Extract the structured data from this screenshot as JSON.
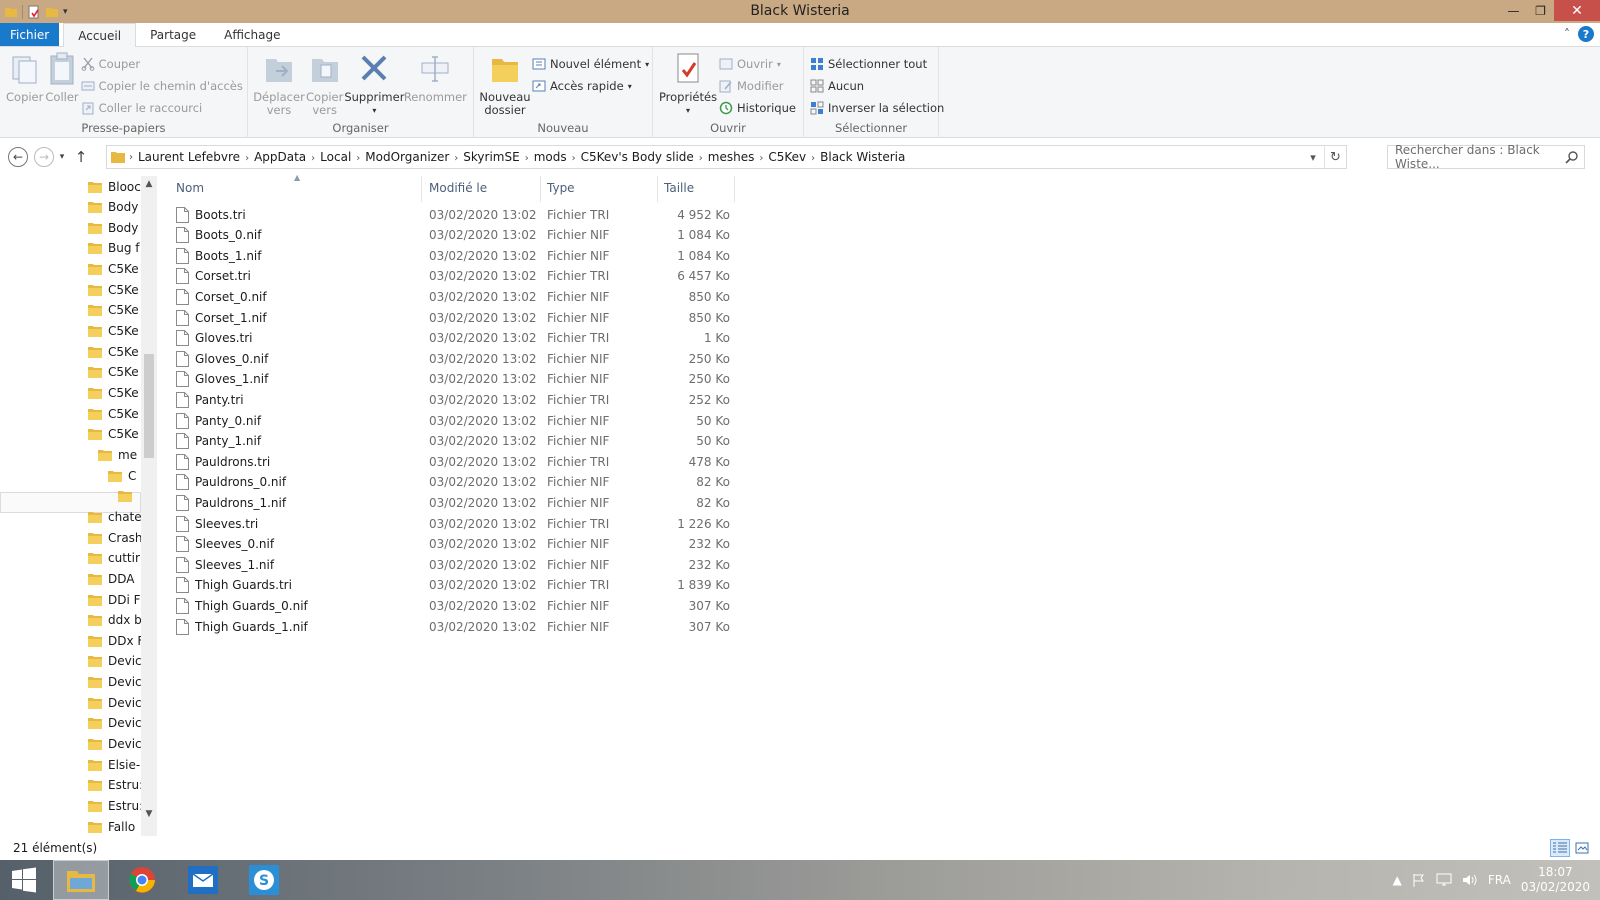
{
  "window": {
    "title": "Black Wisteria"
  },
  "ribbon_tabs": [
    "Fichier",
    "Accueil",
    "Partage",
    "Affichage"
  ],
  "ribbon": {
    "presse_papiers": {
      "label": "Presse-papiers",
      "copier": "Copier",
      "coller": "Coller",
      "couper": "Couper",
      "copier_chemin": "Copier le chemin d'accès",
      "coller_raccourci": "Coller le raccourci"
    },
    "organiser": {
      "label": "Organiser",
      "deplacer_1": "Déplacer",
      "deplacer_2": "vers",
      "copier_vers_1": "Copier",
      "copier_vers_2": "vers",
      "supprimer": "Supprimer",
      "renommer": "Renommer"
    },
    "nouveau": {
      "label": "Nouveau",
      "dossier_1": "Nouveau",
      "dossier_2": "dossier",
      "nouvel_element": "Nouvel élément",
      "acces_rapide": "Accès rapide"
    },
    "ouvrir": {
      "label": "Ouvrir",
      "proprietes": "Propriétés",
      "ouvrir": "Ouvrir",
      "modifier": "Modifier",
      "historique": "Historique"
    },
    "selectionner": {
      "label": "Sélectionner",
      "tout": "Sélectionner tout",
      "aucun": "Aucun",
      "inverser": "Inverser la sélection"
    }
  },
  "address": {
    "breadcrumbs": [
      "Laurent Lefebvre",
      "AppData",
      "Local",
      "ModOrganizer",
      "SkyrimSE",
      "mods",
      "C5Kev's Body slide",
      "meshes",
      "C5Kev",
      "Black Wisteria"
    ],
    "search_placeholder": "Rechercher dans : Black Wiste..."
  },
  "nav_pane": {
    "items": [
      {
        "label": "Blooc",
        "indent": 0
      },
      {
        "label": "Body",
        "indent": 0
      },
      {
        "label": "Body",
        "indent": 0
      },
      {
        "label": "Bug f",
        "indent": 0
      },
      {
        "label": "C5Ke",
        "indent": 0
      },
      {
        "label": "C5Ke",
        "indent": 0
      },
      {
        "label": "C5Ke",
        "indent": 0
      },
      {
        "label": "C5Ke",
        "indent": 0
      },
      {
        "label": "C5Ke",
        "indent": 0
      },
      {
        "label": "C5Ke",
        "indent": 0
      },
      {
        "label": "C5Ke",
        "indent": 0
      },
      {
        "label": "C5Ke",
        "indent": 0
      },
      {
        "label": "C5Ke",
        "indent": 0
      },
      {
        "label": "me",
        "indent": 1
      },
      {
        "label": "C",
        "indent": 2
      },
      {
        "label": "",
        "indent": 3
      },
      {
        "label": "chate",
        "indent": 0
      },
      {
        "label": "Crash",
        "indent": 0
      },
      {
        "label": "cuttir",
        "indent": 0
      },
      {
        "label": "DDA",
        "indent": 0
      },
      {
        "label": "DDi F",
        "indent": 0
      },
      {
        "label": "ddx b",
        "indent": 0
      },
      {
        "label": "DDx F",
        "indent": 0
      },
      {
        "label": "Devic",
        "indent": 0
      },
      {
        "label": "Devic",
        "indent": 0
      },
      {
        "label": "Devic",
        "indent": 0
      },
      {
        "label": "Devic",
        "indent": 0
      },
      {
        "label": "Devic",
        "indent": 0
      },
      {
        "label": "Elsie-",
        "indent": 0
      },
      {
        "label": "Estru:",
        "indent": 0
      },
      {
        "label": "Estru:",
        "indent": 0
      },
      {
        "label": "Fallo",
        "indent": 0
      }
    ]
  },
  "file_list": {
    "columns": {
      "name": "Nom",
      "date": "Modifié le",
      "type": "Type",
      "size": "Taille"
    },
    "rows": [
      {
        "name": "Boots.tri",
        "date": "03/02/2020 13:02",
        "type": "Fichier TRI",
        "size": "4 952 Ko"
      },
      {
        "name": "Boots_0.nif",
        "date": "03/02/2020 13:02",
        "type": "Fichier NIF",
        "size": "1 084 Ko"
      },
      {
        "name": "Boots_1.nif",
        "date": "03/02/2020 13:02",
        "type": "Fichier NIF",
        "size": "1 084 Ko"
      },
      {
        "name": "Corset.tri",
        "date": "03/02/2020 13:02",
        "type": "Fichier TRI",
        "size": "6 457 Ko"
      },
      {
        "name": "Corset_0.nif",
        "date": "03/02/2020 13:02",
        "type": "Fichier NIF",
        "size": "850 Ko"
      },
      {
        "name": "Corset_1.nif",
        "date": "03/02/2020 13:02",
        "type": "Fichier NIF",
        "size": "850 Ko"
      },
      {
        "name": "Gloves.tri",
        "date": "03/02/2020 13:02",
        "type": "Fichier TRI",
        "size": "1 Ko"
      },
      {
        "name": "Gloves_0.nif",
        "date": "03/02/2020 13:02",
        "type": "Fichier NIF",
        "size": "250 Ko"
      },
      {
        "name": "Gloves_1.nif",
        "date": "03/02/2020 13:02",
        "type": "Fichier NIF",
        "size": "250 Ko"
      },
      {
        "name": "Panty.tri",
        "date": "03/02/2020 13:02",
        "type": "Fichier TRI",
        "size": "252 Ko"
      },
      {
        "name": "Panty_0.nif",
        "date": "03/02/2020 13:02",
        "type": "Fichier NIF",
        "size": "50 Ko"
      },
      {
        "name": "Panty_1.nif",
        "date": "03/02/2020 13:02",
        "type": "Fichier NIF",
        "size": "50 Ko"
      },
      {
        "name": "Pauldrons.tri",
        "date": "03/02/2020 13:02",
        "type": "Fichier TRI",
        "size": "478 Ko"
      },
      {
        "name": "Pauldrons_0.nif",
        "date": "03/02/2020 13:02",
        "type": "Fichier NIF",
        "size": "82 Ko"
      },
      {
        "name": "Pauldrons_1.nif",
        "date": "03/02/2020 13:02",
        "type": "Fichier NIF",
        "size": "82 Ko"
      },
      {
        "name": "Sleeves.tri",
        "date": "03/02/2020 13:02",
        "type": "Fichier TRI",
        "size": "1 226 Ko"
      },
      {
        "name": "Sleeves_0.nif",
        "date": "03/02/2020 13:02",
        "type": "Fichier NIF",
        "size": "232 Ko"
      },
      {
        "name": "Sleeves_1.nif",
        "date": "03/02/2020 13:02",
        "type": "Fichier NIF",
        "size": "232 Ko"
      },
      {
        "name": "Thigh Guards.tri",
        "date": "03/02/2020 13:02",
        "type": "Fichier TRI",
        "size": "1 839 Ko"
      },
      {
        "name": "Thigh Guards_0.nif",
        "date": "03/02/2020 13:02",
        "type": "Fichier NIF",
        "size": "307 Ko"
      },
      {
        "name": "Thigh Guards_1.nif",
        "date": "03/02/2020 13:02",
        "type": "Fichier NIF",
        "size": "307 Ko"
      }
    ]
  },
  "status": {
    "item_count": "21 élément(s)"
  },
  "taskbar": {
    "language": "FRA",
    "time": "18:07",
    "date": "03/02/2020",
    "apps": [
      "file-explorer-icon",
      "chrome-icon",
      "mail-icon",
      "skype-icon"
    ]
  },
  "colors": {
    "accent": "#1979ca",
    "titlebar": "#c9a983",
    "close": "#c7504b",
    "folder": "#e8b942"
  }
}
